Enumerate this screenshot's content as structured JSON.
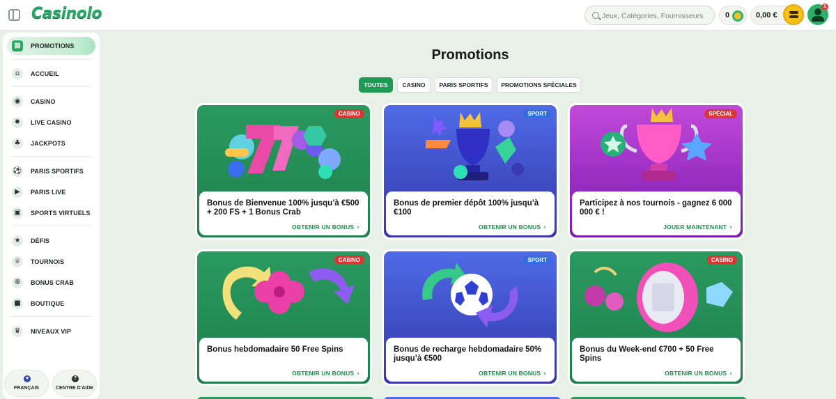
{
  "header": {
    "logo_text": "Casinolo",
    "search_placeholder": "Jeux, Catégories, Fournisseurs",
    "coins_value": "0",
    "balance_value": "0,00 €",
    "notifications_count": "1"
  },
  "sidebar": {
    "items": [
      {
        "label": "PROMOTIONS",
        "icon": "gift-icon",
        "active": true
      },
      {
        "label": "ACCUEIL",
        "icon": "home-icon"
      },
      {
        "label": "CASINO",
        "icon": "casino-chip-icon"
      },
      {
        "label": "LIVE CASINO",
        "icon": "live-casino-icon"
      },
      {
        "label": "JACKPOTS",
        "icon": "clubs-icon"
      },
      {
        "label": "PARIS SPORTIFS",
        "icon": "football-icon"
      },
      {
        "label": "PARIS LIVE",
        "icon": "live-tv-icon"
      },
      {
        "label": "SPORTS VIRTUELS",
        "icon": "virtual-sports-icon"
      },
      {
        "label": "DÉFIS",
        "icon": "star-icon"
      },
      {
        "label": "TOURNOIS",
        "icon": "trophy-icon"
      },
      {
        "label": "BONUS CRAB",
        "icon": "crab-claw-icon"
      },
      {
        "label": "BOUTIQUE",
        "icon": "shop-bag-icon"
      },
      {
        "label": "NIVEAUX VIP",
        "icon": "crown-icon"
      }
    ],
    "footer": {
      "language_label": "FRANÇAIS",
      "help_label": "CENTRE D'AIDE"
    }
  },
  "main": {
    "title": "Promotions",
    "filters": [
      {
        "label": "TOUTES",
        "active": true
      },
      {
        "label": "CASINO"
      },
      {
        "label": "PARIS SPORTIFS"
      },
      {
        "label": "PROMOTIONS SPÉCIALES"
      }
    ],
    "cards": [
      {
        "badge": "CASINO",
        "title": "Bonus de Bienvenue 100% jusqu’à €500 + 200 FS + 1 Bonus Crab",
        "cta": "OBTENIR UN BONUS",
        "theme": "green"
      },
      {
        "badge": "SPORT",
        "title": "Bonus de premier dépôt 100% jusqu’à €100",
        "cta": "OBTENIR UN BONUS",
        "theme": "blue"
      },
      {
        "badge": "SPÉCIAL",
        "title": "Participez à nos tournois - gagnez 6 000 000 € !",
        "cta": "JOUER MAINTENANT",
        "theme": "purple"
      },
      {
        "badge": "CASINO",
        "title": "Bonus hebdomadaire 50 Free Spins",
        "cta": "OBTENIR UN BONUS",
        "theme": "green"
      },
      {
        "badge": "SPORT",
        "title": "Bonus de recharge hebdomadaire 50% jusqu’à €500",
        "cta": "OBTENIR UN BONUS",
        "theme": "blue"
      },
      {
        "badge": "CASINO",
        "title": "Bonus du Week-end €700 + 50 Free Spins",
        "cta": "OBTENIR UN BONUS",
        "theme": "green"
      }
    ]
  },
  "colors": {
    "brand_green": "#2aa867",
    "badge_red": "#d93636",
    "badge_blue": "#2f6fe0",
    "page_bg": "#e7f1e8"
  }
}
